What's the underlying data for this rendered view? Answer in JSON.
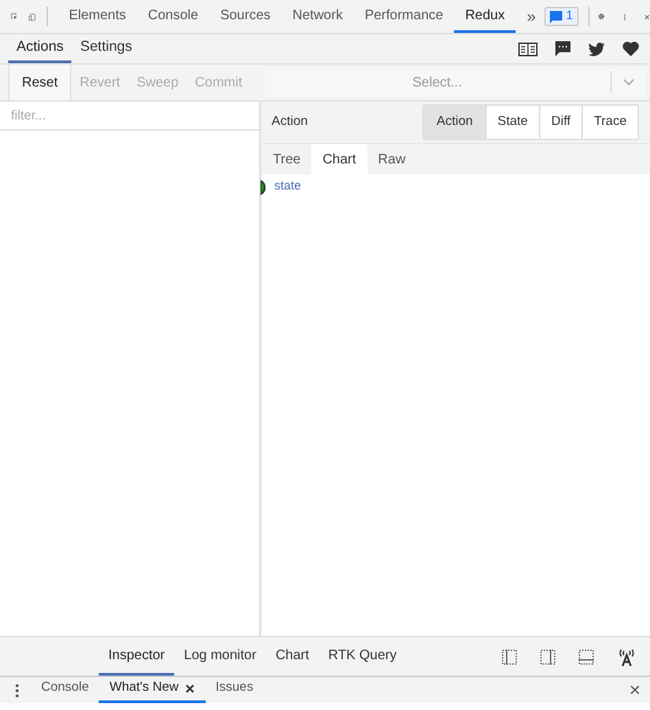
{
  "devtools_tabs": [
    {
      "label": "Elements",
      "selected": false
    },
    {
      "label": "Console",
      "selected": false
    },
    {
      "label": "Sources",
      "selected": false
    },
    {
      "label": "Network",
      "selected": false
    },
    {
      "label": "Performance",
      "selected": false
    },
    {
      "label": "Redux",
      "selected": true
    }
  ],
  "overflow": "»",
  "issues_badge": "1",
  "redux_tabs": [
    {
      "label": "Actions",
      "selected": true
    },
    {
      "label": "Settings",
      "selected": false
    }
  ],
  "toolbar": [
    {
      "label": "Reset",
      "disabled": false
    },
    {
      "label": "Revert",
      "disabled": true
    },
    {
      "label": "Sweep",
      "disabled": true
    },
    {
      "label": "Commit",
      "disabled": true
    }
  ],
  "instance_select": {
    "placeholder": "Select..."
  },
  "filter": {
    "placeholder": "filter..."
  },
  "preview": {
    "title": "Action",
    "tabs": [
      {
        "label": "Action",
        "selected": true
      },
      {
        "label": "State",
        "selected": false
      },
      {
        "label": "Diff",
        "selected": false
      },
      {
        "label": "Trace",
        "selected": false
      }
    ],
    "subtabs": [
      {
        "label": "Tree",
        "selected": false
      },
      {
        "label": "Chart",
        "selected": true
      },
      {
        "label": "Raw",
        "selected": false
      }
    ],
    "chart_node": "state"
  },
  "monitor_tabs": [
    {
      "label": "Inspector",
      "selected": true
    },
    {
      "label": "Log monitor",
      "selected": false
    },
    {
      "label": "Chart",
      "selected": false
    },
    {
      "label": "RTK Query",
      "selected": false
    }
  ],
  "drawer_tabs": [
    {
      "label": "Console",
      "selected": false,
      "closable": false
    },
    {
      "label": "What's New",
      "selected": true,
      "closable": true
    },
    {
      "label": "Issues",
      "selected": false,
      "closable": false
    }
  ],
  "drawer_close": "×"
}
